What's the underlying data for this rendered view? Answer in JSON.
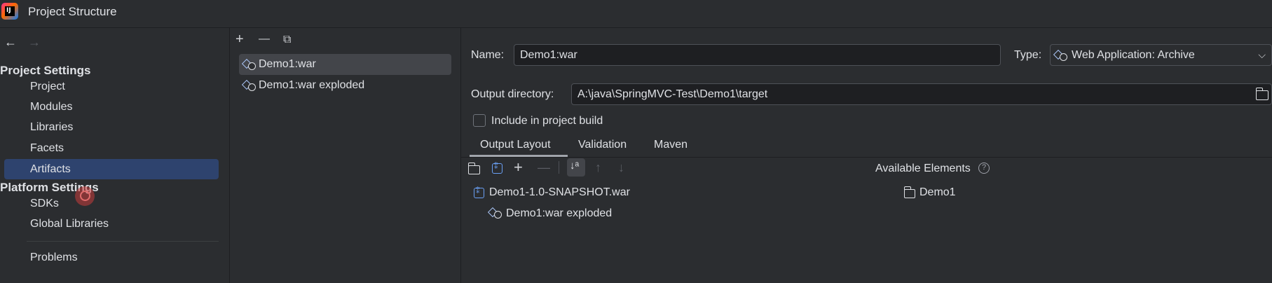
{
  "window": {
    "title": "Project Structure"
  },
  "nav": {
    "back": "←",
    "forward": "→"
  },
  "sidebar": {
    "project_settings_header": "Project Settings",
    "platform_settings_header": "Platform Settings",
    "items": [
      {
        "label": "Project"
      },
      {
        "label": "Modules"
      },
      {
        "label": "Libraries"
      },
      {
        "label": "Facets"
      },
      {
        "label": "Artifacts",
        "selected": true
      },
      {
        "label": "SDKs"
      },
      {
        "label": "Global Libraries"
      },
      {
        "label": "Problems"
      }
    ]
  },
  "artifacts_toolbar": {
    "add": "+",
    "remove": "—",
    "copy": "⧉"
  },
  "artifacts": [
    {
      "label": "Demo1:war",
      "selected": true
    },
    {
      "label": "Demo1:war exploded"
    }
  ],
  "details": {
    "name_label": "Name:",
    "name_value": "Demo1:war",
    "type_label": "Type:",
    "type_value": "Web Application: Archive",
    "output_dir_label": "Output directory:",
    "output_dir_value": "A:\\java\\SpringMVC-Test\\Demo1\\target",
    "include_label": "Include in project build",
    "include_checked": false
  },
  "tabs": [
    {
      "label": "Output Layout",
      "active": true
    },
    {
      "label": "Validation"
    },
    {
      "label": "Maven"
    }
  ],
  "layout_toolbar": {
    "add": "+",
    "remove": "—",
    "sort": "↓ᵃ",
    "up": "↑",
    "down": "↓"
  },
  "available_elements_label": "Available Elements",
  "output_tree": [
    {
      "label": "Demo1-1.0-SNAPSHOT.war"
    },
    {
      "label": "Demo1:war exploded"
    }
  ],
  "available_tree": [
    {
      "label": "Demo1"
    }
  ],
  "colors": {
    "selection": "#2e436e",
    "background": "#2b2d30",
    "field": "#1e1f22",
    "accent_icon": "#6aa0f5"
  }
}
